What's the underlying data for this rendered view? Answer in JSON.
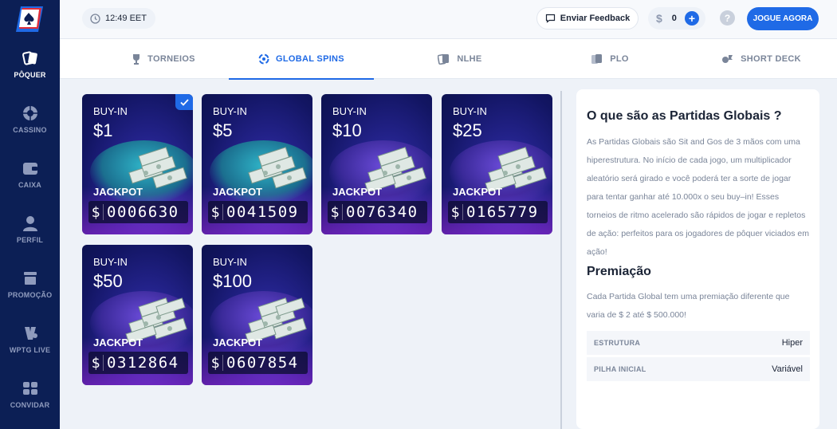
{
  "sidebar": {
    "logo": "spade-logo",
    "items": [
      {
        "label": "PÔQUER",
        "icon": "poker-cards-icon",
        "active": true
      },
      {
        "label": "CASSINO",
        "icon": "roulette-icon",
        "active": false
      },
      {
        "label": "CAIXA",
        "icon": "wallet-icon",
        "active": false
      },
      {
        "label": "PERFIL",
        "icon": "user-icon",
        "active": false
      },
      {
        "label": "PROMOÇÃO",
        "icon": "gift-icon",
        "active": false
      },
      {
        "label": "WPTG LIVE",
        "icon": "wptg-icon",
        "active": false
      },
      {
        "label": "CONVIDAR",
        "icon": "ticket-icon",
        "active": false
      }
    ]
  },
  "header": {
    "time": "12:49 EET",
    "feedback_label": "Enviar Feedback",
    "balance_currency": "$",
    "balance_amount": "0",
    "help_label": "?",
    "play_label": "JOGUE AGORA"
  },
  "tabs": [
    {
      "label": "TORNEIOS",
      "icon": "trophy-icon",
      "active": false
    },
    {
      "label": "GLOBAL SPINS",
      "icon": "spin-icon",
      "active": true
    },
    {
      "label": "NLHE",
      "icon": "cards-icon",
      "active": false
    },
    {
      "label": "PLO",
      "icon": "cards-stack-icon",
      "active": false
    },
    {
      "label": "SHORT DECK",
      "icon": "chess-icon",
      "active": false
    }
  ],
  "cards": [
    {
      "buyin_label": "BUY-IN",
      "amount": "$1",
      "jackpot_label": "JACKPOT",
      "jackpot_currency": "$",
      "jackpot_value": "0006630",
      "selected": true
    },
    {
      "buyin_label": "BUY-IN",
      "amount": "$5",
      "jackpot_label": "JACKPOT",
      "jackpot_currency": "$",
      "jackpot_value": "0041509",
      "selected": false
    },
    {
      "buyin_label": "BUY-IN",
      "amount": "$10",
      "jackpot_label": "JACKPOT",
      "jackpot_currency": "$",
      "jackpot_value": "0076340",
      "selected": false
    },
    {
      "buyin_label": "BUY-IN",
      "amount": "$25",
      "jackpot_label": "JACKPOT",
      "jackpot_currency": "$",
      "jackpot_value": "0165779",
      "selected": false
    },
    {
      "buyin_label": "BUY-IN",
      "amount": "$50",
      "jackpot_label": "JACKPOT",
      "jackpot_currency": "$",
      "jackpot_value": "0312864",
      "selected": false
    },
    {
      "buyin_label": "BUY-IN",
      "amount": "$100",
      "jackpot_label": "JACKPOT",
      "jackpot_currency": "$",
      "jackpot_value": "0607854",
      "selected": false
    }
  ],
  "info": {
    "title": "O que são as Partidas Globais ?",
    "description": "As Partidas Globais são Sit and Gos de 3 mãos com uma hiperestrutura. No início de cada jogo, um multiplicador aleatório será girado e você poderá ter a sorte de jogar para tentar ganhar até 10.000x o seu buy–in! Esses torneios de ritmo acelerado são rápidos de jogar e repletos de ação: perfeitos para os jogadores de pôquer viciados em ação!",
    "prize_title": "Premiação",
    "prize_description": "Cada Partida Global tem uma premiação diferente que varia de $ 2 até $ 500.000!",
    "rows": [
      {
        "key": "ESTRUTURA",
        "value": "Hiper"
      },
      {
        "key": "PILHA INICIAL",
        "value": "Variável"
      }
    ]
  },
  "colors": {
    "sidebar": "#0c1f55",
    "accent": "#1f6ae6",
    "card_dark": "#121562",
    "card_glow": "#9628dc"
  }
}
